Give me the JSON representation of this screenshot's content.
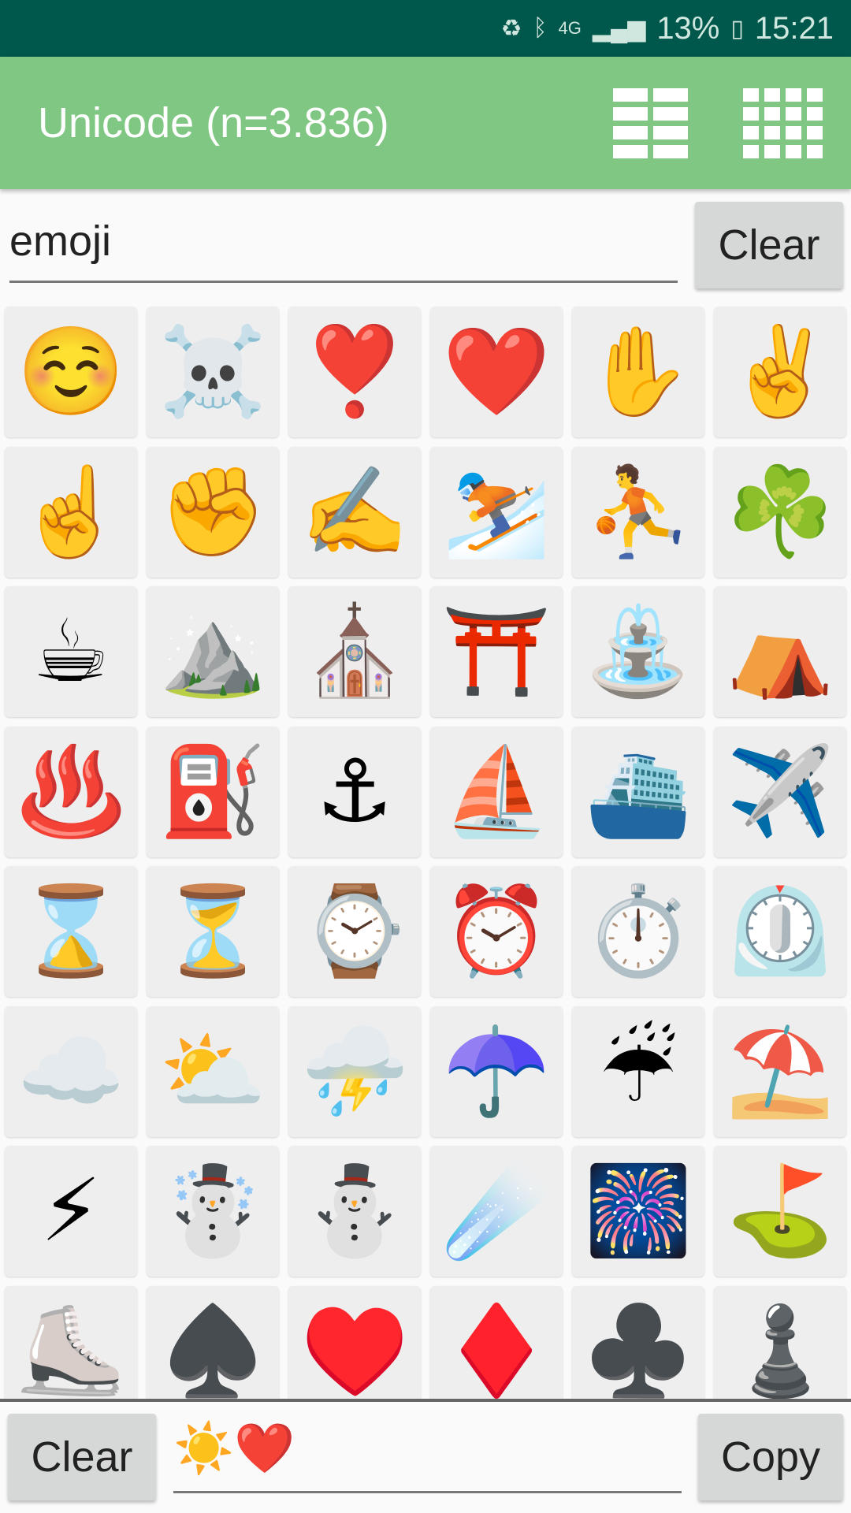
{
  "status_bar": {
    "icons": [
      "battery-saver-icon",
      "bluetooth-icon",
      "4g-icon",
      "signal-icon"
    ],
    "battery": "13%",
    "time": "15:21"
  },
  "app_bar": {
    "title": "Unicode (n=3.836)",
    "icons": [
      "grid-2-columns-icon",
      "grid-4-columns-icon"
    ]
  },
  "search": {
    "value": "emoji",
    "clear_label": "Clear"
  },
  "grid": {
    "items": [
      "☺️",
      "☠️",
      "❣️",
      "❤️",
      "✋",
      "✌️",
      "☝️",
      "✊",
      "✍️",
      "⛷️",
      "⛹️",
      "☘️",
      "☕",
      "⛰️",
      "⛪",
      "⛩️",
      "⛲",
      "⛺",
      "♨️",
      "⛽",
      "⚓",
      "⛵",
      "⛴️",
      "✈️",
      "⌛",
      "⏳",
      "⌚",
      "⏰",
      "⏱️",
      "⏲️",
      "☁️",
      "⛅",
      "⛈️",
      "☂️",
      "☔",
      "⛱️",
      "⚡",
      "☃️",
      "⛄",
      "☄️",
      "🎆",
      "⛳",
      "⛸️",
      "♠️",
      "♥️",
      "♦️",
      "♣️",
      "♟️"
    ]
  },
  "bottom": {
    "clear_label": "Clear",
    "output": "☀️❤️",
    "copy_label": "Copy"
  }
}
